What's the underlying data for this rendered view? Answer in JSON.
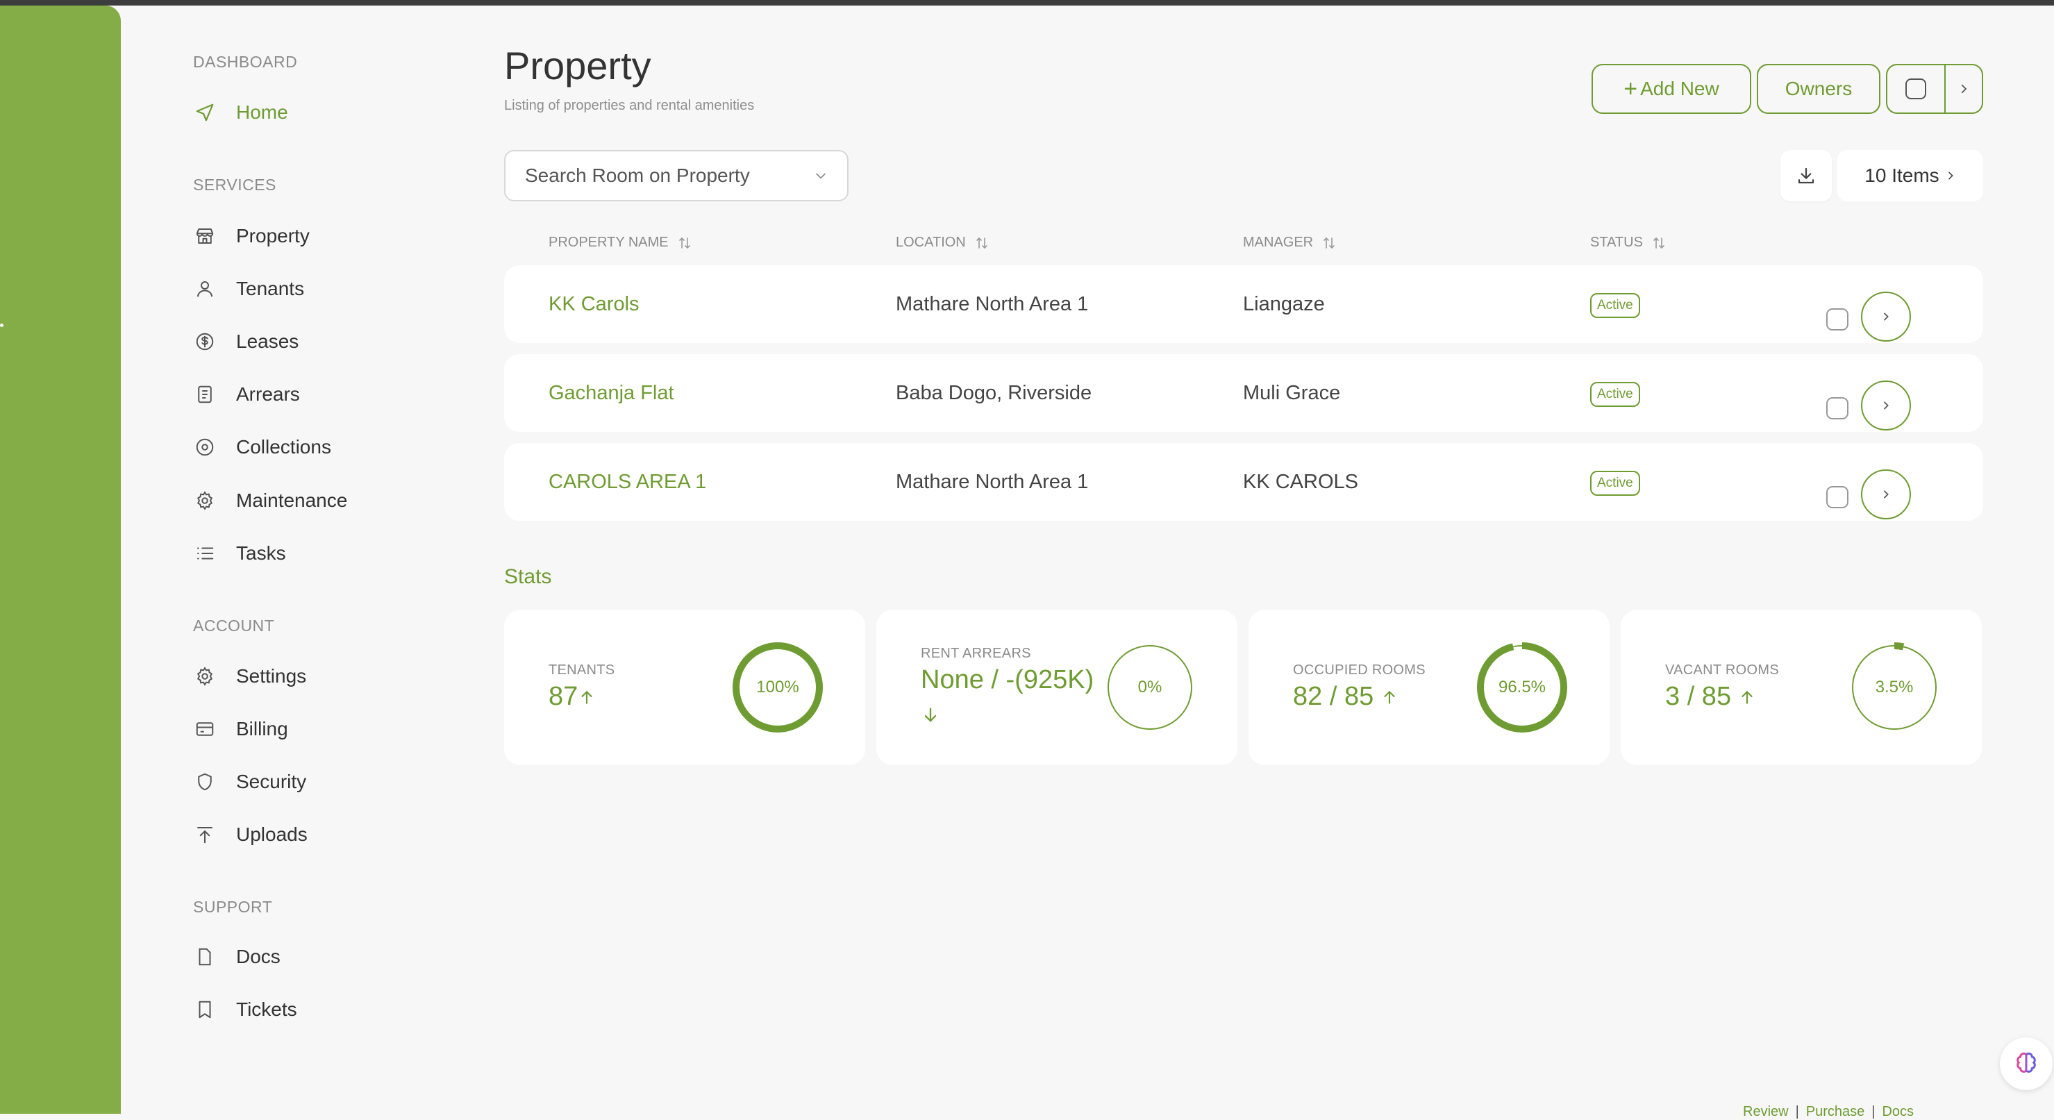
{
  "sidebar": {
    "sections": [
      {
        "heading": "DASHBOARD",
        "items": [
          {
            "label": "Home",
            "icon": "send-icon",
            "active": true
          }
        ]
      },
      {
        "heading": "SERVICES",
        "items": [
          {
            "label": "Property",
            "icon": "store-icon"
          },
          {
            "label": "Tenants",
            "icon": "user-icon"
          },
          {
            "label": "Leases",
            "icon": "dollar-circle-icon"
          },
          {
            "label": "Arrears",
            "icon": "receipt-icon"
          },
          {
            "label": "Collections",
            "icon": "target-icon"
          },
          {
            "label": "Maintenance",
            "icon": "gear-icon"
          },
          {
            "label": "Tasks",
            "icon": "list-icon"
          }
        ]
      },
      {
        "heading": "ACCOUNT",
        "items": [
          {
            "label": "Settings",
            "icon": "gear-icon"
          },
          {
            "label": "Billing",
            "icon": "credit-card-icon"
          },
          {
            "label": "Security",
            "icon": "shield-icon"
          },
          {
            "label": "Uploads",
            "icon": "upload-icon"
          }
        ]
      },
      {
        "heading": "SUPPORT",
        "items": [
          {
            "label": "Docs",
            "icon": "file-icon"
          },
          {
            "label": "Tickets",
            "icon": "bookmark-icon"
          }
        ]
      }
    ]
  },
  "header": {
    "title": "Property",
    "subtitle": "Listing of properties and rental amenities",
    "add_new_label": "Add New",
    "owners_label": "Owners"
  },
  "toolbar": {
    "search_placeholder": "Search Room on Property",
    "items_label": "10 Items"
  },
  "table": {
    "columns": [
      "PROPERTY NAME",
      "LOCATION",
      "MANAGER",
      "STATUS"
    ],
    "rows": [
      {
        "name": "KK Carols",
        "location": "Mathare North Area 1",
        "manager": "Liangaze",
        "status": "Active"
      },
      {
        "name": "Gachanja Flat",
        "location": "Baba Dogo, Riverside",
        "manager": "Muli Grace",
        "status": "Active"
      },
      {
        "name": "CAROLS AREA 1",
        "location": "Mathare North Area 1",
        "manager": "KK CAROLS",
        "status": "Active"
      }
    ]
  },
  "stats": {
    "title": "Stats",
    "cards": [
      {
        "label": "TENANTS",
        "value": "87",
        "trend": "up",
        "percent_text": "100%",
        "percent": 100
      },
      {
        "label": "RENT ARREARS",
        "value": "None / -(925K)",
        "trend": "down",
        "percent_text": "0%",
        "percent": 0
      },
      {
        "label": "OCCUPIED ROOMS",
        "value": "82 / 85",
        "trend": "up",
        "percent_text": "96.5%",
        "percent": 96.5
      },
      {
        "label": "VACANT ROOMS",
        "value": "3 / 85",
        "trend": "up",
        "percent_text": "3.5%",
        "percent": 3.5
      }
    ]
  },
  "footer": {
    "links": [
      "Review",
      "Purchase",
      "Docs"
    ]
  },
  "colors": {
    "accent": "#6f9c32",
    "rail": "#85ad47"
  }
}
